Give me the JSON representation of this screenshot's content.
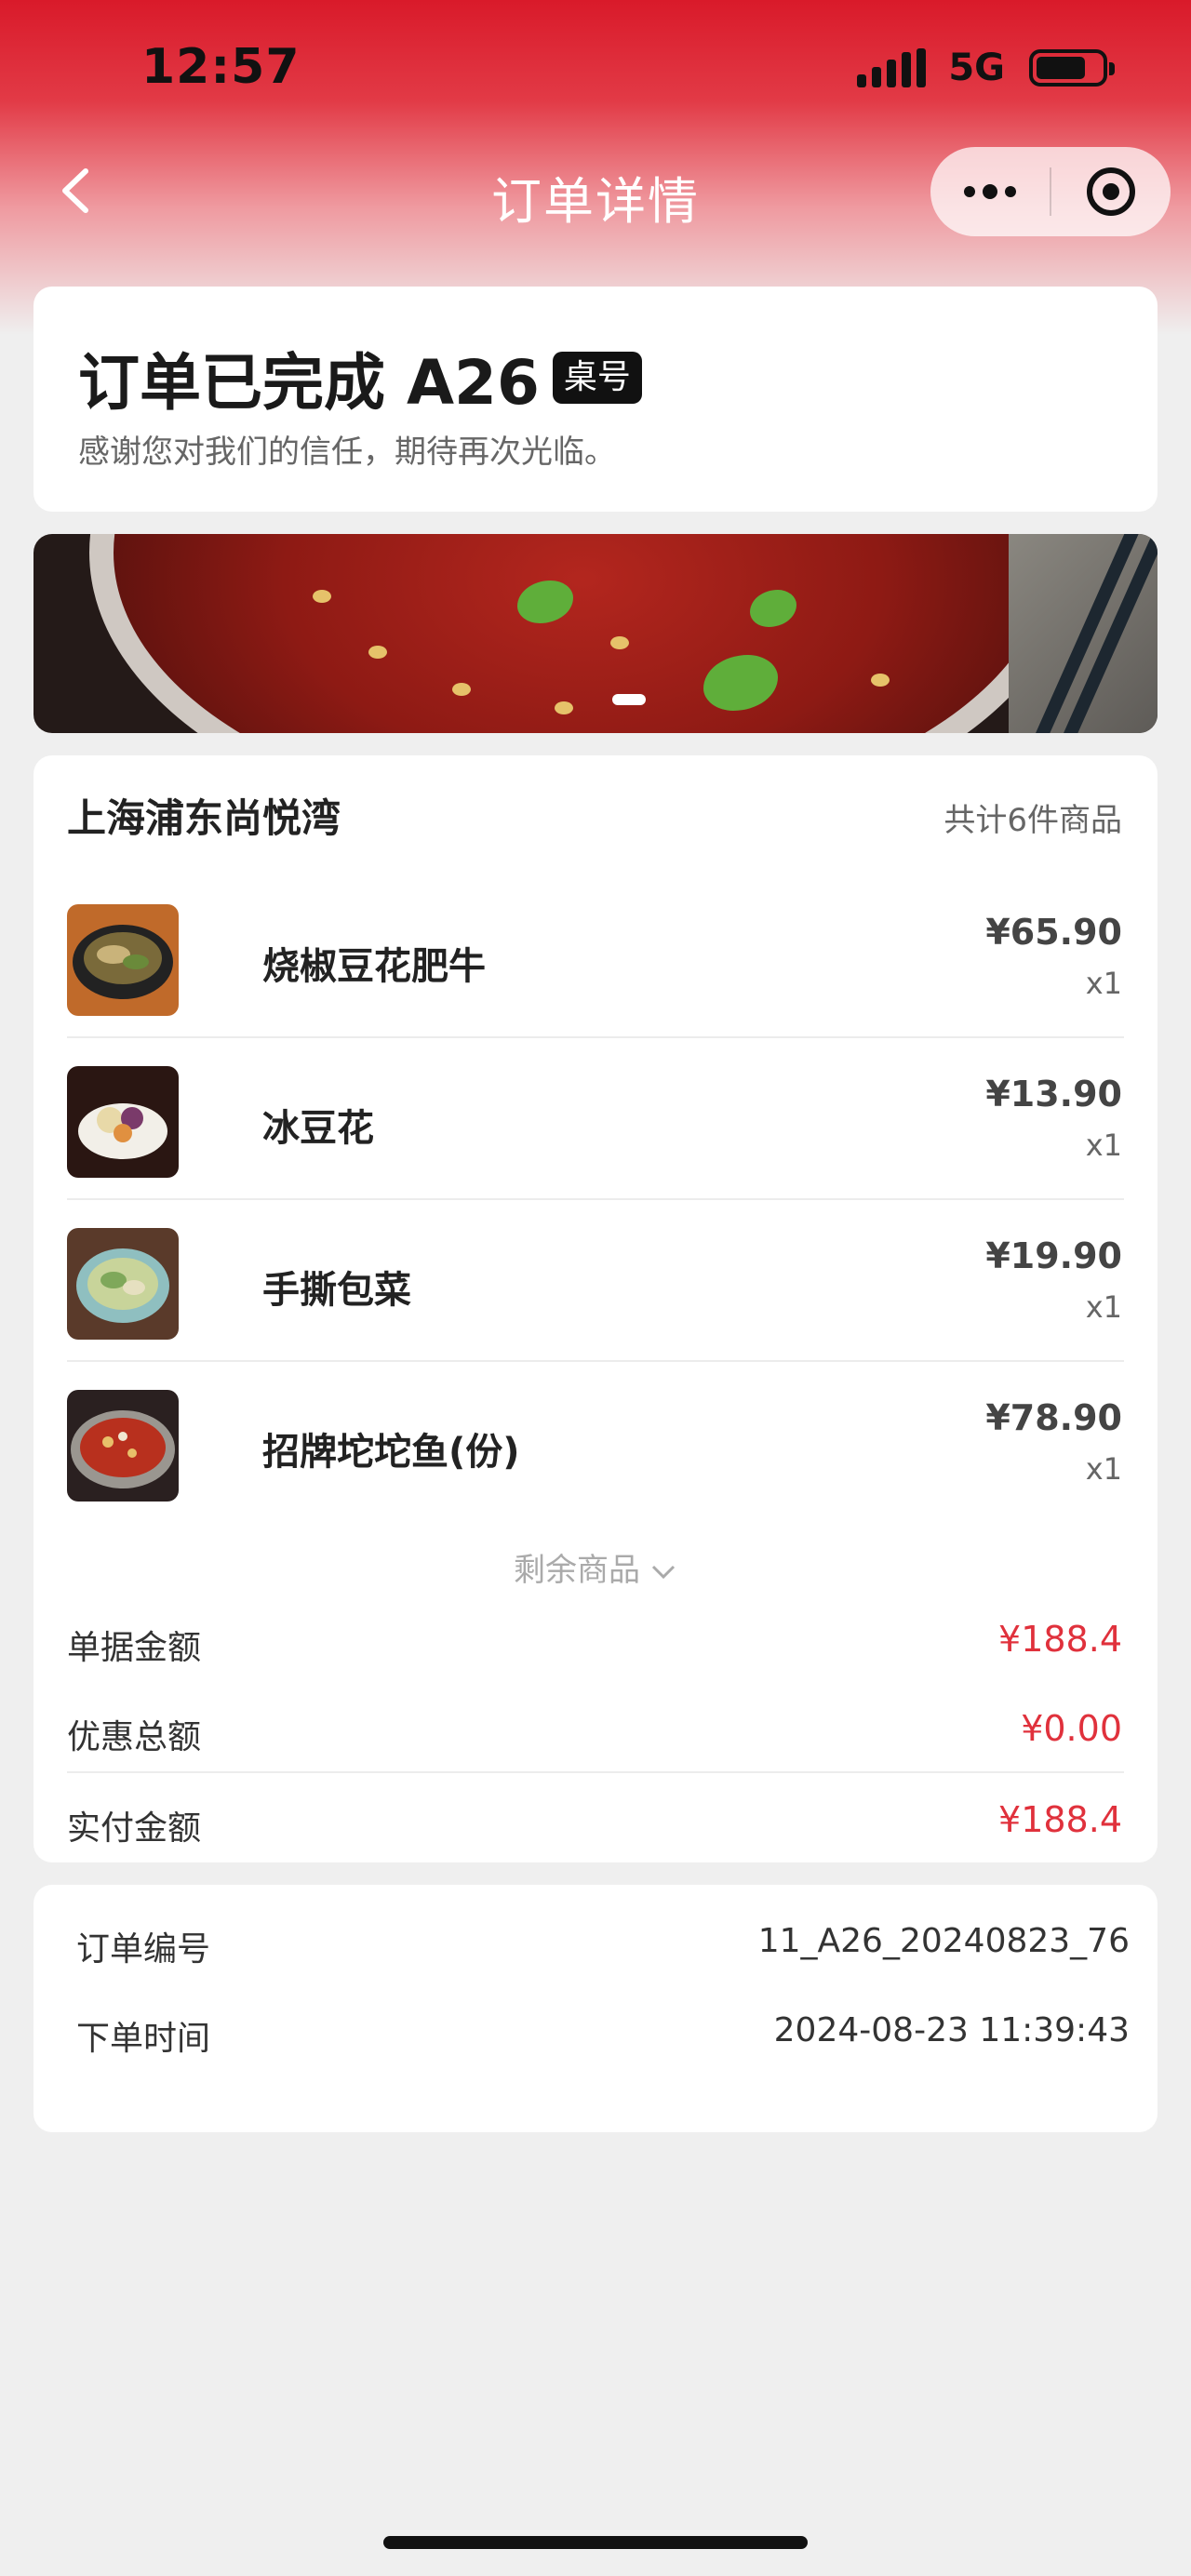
{
  "status_bar": {
    "time": "12:57",
    "network": "5G",
    "battery_level": 0.76
  },
  "nav": {
    "title": "订单详情"
  },
  "order_status": {
    "title": "订单已完成 A26",
    "table_badge": "桌号",
    "subtitle": "感谢您对我们的信任，期待再次光临。"
  },
  "order": {
    "store_name": "上海浦东尚悦湾",
    "item_count": "共计6件商品",
    "items": [
      {
        "name": "烧椒豆花肥牛",
        "price": "¥65.90",
        "qty": "x1",
        "image": "braised-beef-tofu-photo"
      },
      {
        "name": "冰豆花",
        "price": "¥13.90",
        "qty": "x1",
        "image": "iced-tofu-pudding-photo"
      },
      {
        "name": "手撕包菜",
        "price": "¥19.90",
        "qty": "x1",
        "image": "hand-torn-cabbage-photo"
      },
      {
        "name": "招牌坨坨鱼(份)",
        "price": "¥78.90",
        "qty": "x1",
        "image": "signature-fish-photo"
      }
    ],
    "more_items_label": "剩余商品",
    "summary": [
      {
        "label": "单据金额",
        "value": "¥188.4"
      },
      {
        "label": "优惠总额",
        "value": "¥0.00"
      },
      {
        "label": "实付金额",
        "value": "¥188.4"
      }
    ]
  },
  "info": {
    "order_no_label": "订单编号",
    "order_no": "11_A26_20240823_76",
    "order_time_label": "下单时间",
    "order_time": "2024-08-23 11:39:43"
  },
  "colors": {
    "brand_red": "#d91a2a",
    "price_red": "#e0313c"
  }
}
